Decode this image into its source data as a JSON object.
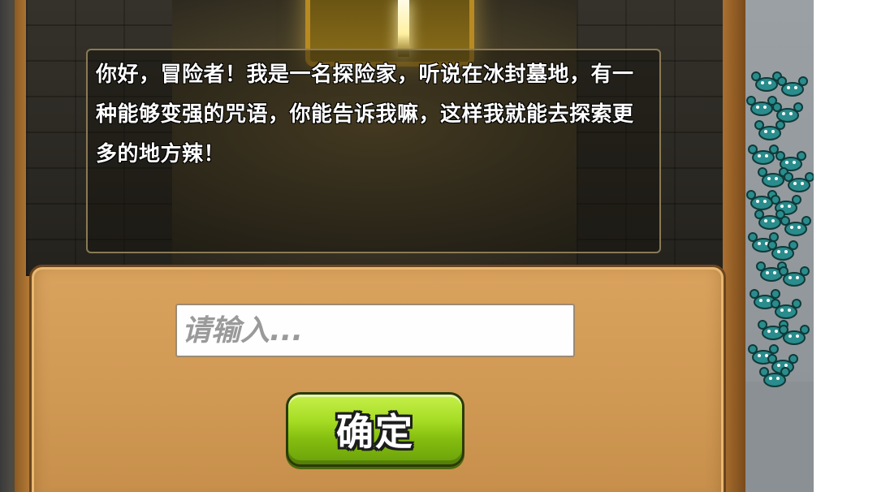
{
  "dialog": {
    "message": "你好，冒险者！我是一名探险家，听说在冰封墓地，有一种能够变强的咒语，你能告诉我嘛，这样我就能去探索更多的地方辣！"
  },
  "input": {
    "placeholder": "请输入...",
    "value": ""
  },
  "confirm_button": {
    "label": "确定"
  },
  "colors": {
    "parchment": "#d9a25d",
    "button_green": "#a6dc24",
    "dialog_text": "#ffffff",
    "crab_teal": "#2a8c8c"
  },
  "icons": {
    "crab_swarm": "crab-monster-icon"
  }
}
